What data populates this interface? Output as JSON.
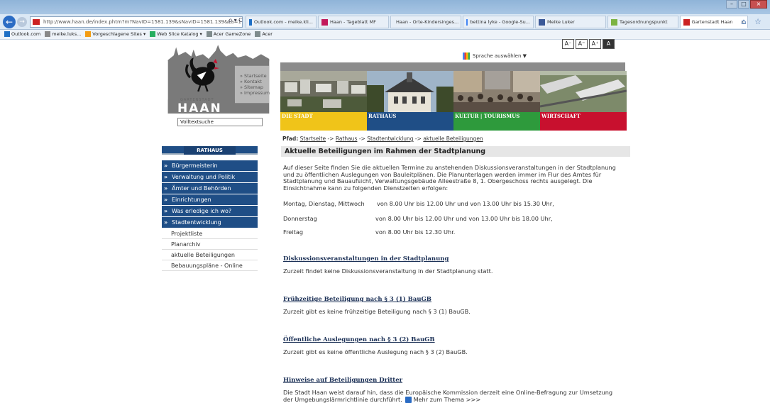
{
  "browser": {
    "address": "http://www.haan.de/index.phtm?m?NavID=1581.139&sNavID=1581.139&La=1",
    "address_icons": "ρ ▾ C",
    "tabs": [
      {
        "label": "Outlook.com - meike.kli...",
        "color": "#1f6fc5"
      },
      {
        "label": "Haan - Tageblatt MF",
        "color": "#c2185b"
      },
      {
        "label": "Haan - Orte-Kindersinges...",
        "color": "#1565c0"
      },
      {
        "label": "bettina lyke - Google-Su...",
        "color": "#4285f4"
      },
      {
        "label": "Meike Luker",
        "color": "#3b5998"
      },
      {
        "label": "Tagesordnungspunkt",
        "color": "#7cb342"
      },
      {
        "label": "Gartenstadt Haan",
        "color": "#cc2222",
        "active": true
      }
    ],
    "tab_close": "×",
    "favorites": [
      {
        "label": "Outlook.com",
        "color": "#1f6fc5"
      },
      {
        "label": "meike.luks...",
        "color": "#888888"
      },
      {
        "label": "Vorgeschlagene Sites ▾",
        "color": "#f39c12"
      },
      {
        "label": "Web Slice Katalog ▾",
        "color": "#27ae60"
      },
      {
        "label": "Acer GameZone",
        "color": "#7f8c8d"
      },
      {
        "label": "Acer",
        "color": "#7f8c8d"
      }
    ]
  },
  "header": {
    "font_sizes": [
      "A⁻",
      "A⁼",
      "A⁺",
      "A"
    ],
    "language": "Sprache auswählen  ▼",
    "logo_small": "GARTENSTADT",
    "logo_text": "HAAN",
    "quicklinks": [
      "» Startseite",
      "» Kontakt",
      "» Sitemap",
      "» Impressum"
    ],
    "search_value": "Volltextsuche",
    "nav_tabs": [
      {
        "label": "DIE STADT",
        "color": "#f0c419"
      },
      {
        "label": "RATHAUS",
        "color": "#1f4e86"
      },
      {
        "label": "KULTUR | TOURISMUS",
        "color": "#2e9a3c"
      },
      {
        "label": "WIRTSCHAFT",
        "color": "#c8102e"
      }
    ]
  },
  "breadcrumb": {
    "prefix": "Pfad:",
    "items": [
      "Startseite",
      "Rathaus",
      "Stadtentwicklung",
      "aktuelle Beteiligungen"
    ],
    "sep": " -> "
  },
  "sidebar": {
    "heading": "RATHAUS",
    "main_items": [
      "Bürgermeisterin",
      "Verwaltung und Politik",
      "Ämter und Behörden",
      "Einrichtungen",
      "Was erledige ich wo?",
      "Stadtentwicklung"
    ],
    "sub_items": [
      "Projektliste",
      "Planarchiv",
      "aktuelle Beteiligungen",
      "Bebauungspläne - Online"
    ]
  },
  "content": {
    "title": "Aktuelle Beteiligungen im Rahmen der Stadtplanung",
    "intro": "Auf dieser Seite finden Sie die aktuellen Termine zu anstehenden Diskussionsveranstaltungen in der Stadtplanung und zu öffentlichen Auslegungen von Bauleitplänen. Die Planunterlagen werden immer im Flur des Amtes für Stadtplanung und Bauaufsicht, Verwaltungsgebäude Alleestraße 8, 1. Obergeschoss rechts ausgelegt. Die Einsichtnahme kann zu folgenden Dienstzeiten erfolgen:",
    "hours": [
      {
        "days": "Montag, Dienstag, Mittwoch",
        "times": "von 8.00 Uhr bis 12.00 Uhr und von 13.00 Uhr bis 15.30 Uhr,"
      },
      {
        "days": "Donnerstag",
        "times": "von 8.00 Uhr bis 12.00 Uhr und von 13.00 Uhr bis 18.00 Uhr,"
      },
      {
        "days": "Freitag",
        "times": "von 8.00 Uhr bis 12.30 Uhr."
      }
    ],
    "sections": [
      {
        "heading": "Diskussionsveranstaltungen in der Stadtplanung",
        "text": "Zurzeit findet keine Diskussionsveranstaltung in der Stadtplanung statt."
      },
      {
        "heading": "Frühzeitige Beteiligung nach § 3 (1) BauGB",
        "text": "Zurzeit gibt es keine frühzeitige Beteiligung nach § 3 (1) BauGB."
      },
      {
        "heading": "Öffentliche Auslegungen nach § 3 (2) BauGB",
        "text": "Zurzeit gibt es keine öffentliche Auslegung nach § 3 (2) BauGB."
      },
      {
        "heading": "Hinweise auf Beteiligungen Dritter",
        "text": "Die Stadt Haan weist darauf hin, dass die Europäische Kommission derzeit eine Online-Befragung zur Umsetzung der Umgebungslärmrichtlinie durchführt."
      }
    ],
    "more_link": "Mehr zum Thema >>>"
  }
}
